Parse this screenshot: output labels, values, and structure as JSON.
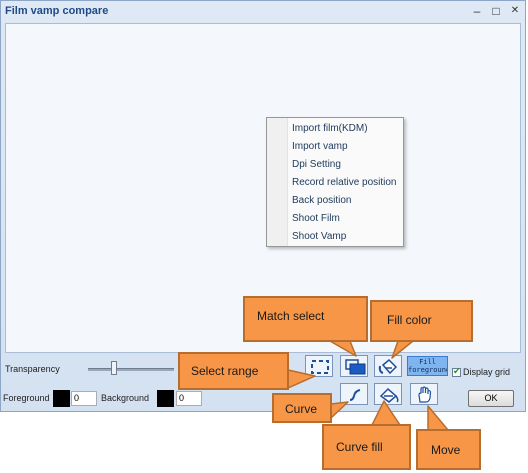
{
  "window": {
    "title": "Film vamp compare",
    "minimize_glyph": "–",
    "maximize_glyph": "□",
    "close_glyph": "✕"
  },
  "context_menu": {
    "items": [
      "Import film(KDM)",
      "Import vamp",
      "Dpi Setting",
      "Record relative position",
      "Back position",
      "Shoot Film",
      "Shoot Vamp"
    ]
  },
  "controls": {
    "transparency_label": "Transparency",
    "transparency_level_fraction": 0.29,
    "foreground_label": "Foreground",
    "foreground_value": "0",
    "background_label": "Background",
    "background_value": "0",
    "fill_button_label": "Fill foreground",
    "display_grid_label": "Display grid",
    "display_grid_checked": true,
    "ok_label": "OK"
  },
  "tools": [
    {
      "name": "select-range-tool",
      "icon": "dashed-rectangle-icon"
    },
    {
      "name": "match-select-tool",
      "icon": "overlapping-rectangles-icon"
    },
    {
      "name": "fill-color-tool",
      "icon": "paint-bucket-icon"
    },
    {
      "name": "curve-tool",
      "icon": "curve-icon"
    },
    {
      "name": "curve-fill-tool",
      "icon": "curve-fill-icon"
    },
    {
      "name": "move-tool",
      "icon": "hand-icon"
    }
  ],
  "callouts": {
    "match_select": "Match select",
    "fill_color": "Fill color",
    "select_range": "Select range",
    "curve": "Curve",
    "curve_fill": "Curve fill",
    "move": "Move"
  },
  "colors": {
    "callout": "#f79646",
    "callout_border": "#b66d2e",
    "window_bg": "#d4e1f1",
    "canvas_bg": "#f4f8fc"
  }
}
